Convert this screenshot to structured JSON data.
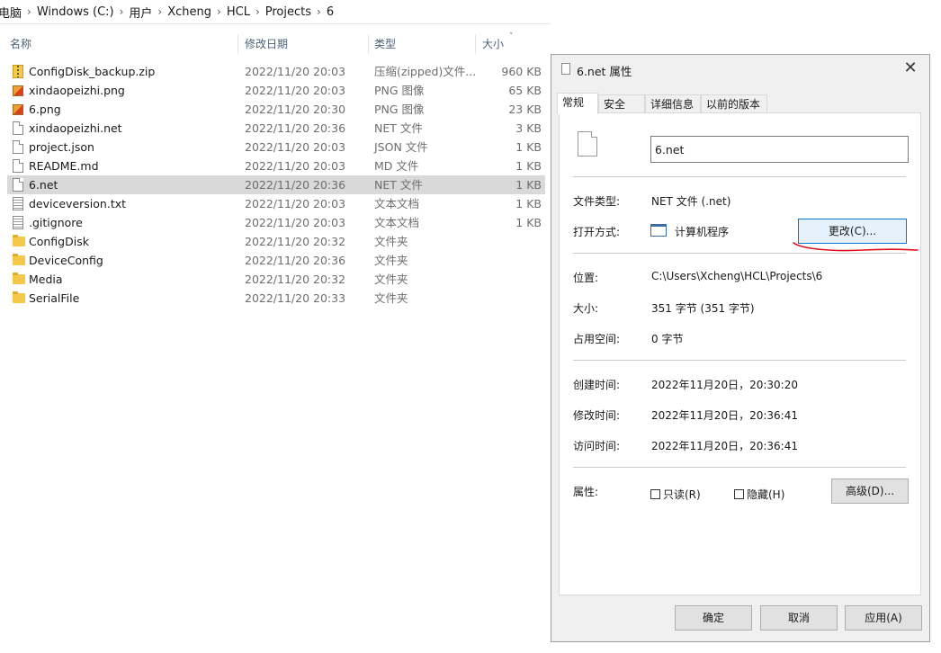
{
  "breadcrumb": [
    "电脑",
    "Windows (C:)",
    "用户",
    "Xcheng",
    "HCL",
    "Projects",
    "6"
  ],
  "columns": {
    "name": "名称",
    "date": "修改日期",
    "type": "类型",
    "size": "大小"
  },
  "files": [
    {
      "name": "ConfigDisk_backup.zip",
      "date": "2022/11/20 20:03",
      "type": "压缩(zipped)文件...",
      "size": "960 KB",
      "icon": "zip-icon"
    },
    {
      "name": "xindaopeizhi.png",
      "date": "2022/11/20 20:03",
      "type": "PNG 图像",
      "size": "65 KB",
      "icon": "image-icon"
    },
    {
      "name": "6.png",
      "date": "2022/11/20 20:30",
      "type": "PNG 图像",
      "size": "23 KB",
      "icon": "image-icon"
    },
    {
      "name": "xindaopeizhi.net",
      "date": "2022/11/20 20:36",
      "type": "NET 文件",
      "size": "3 KB",
      "icon": "file-icon"
    },
    {
      "name": "project.json",
      "date": "2022/11/20 20:03",
      "type": "JSON 文件",
      "size": "1 KB",
      "icon": "file-icon"
    },
    {
      "name": "README.md",
      "date": "2022/11/20 20:03",
      "type": "MD 文件",
      "size": "1 KB",
      "icon": "file-icon"
    },
    {
      "name": "6.net",
      "date": "2022/11/20 20:36",
      "type": "NET 文件",
      "size": "1 KB",
      "icon": "file-icon",
      "selected": true
    },
    {
      "name": "deviceversion.txt",
      "date": "2022/11/20 20:03",
      "type": "文本文档",
      "size": "1 KB",
      "icon": "text-file-icon"
    },
    {
      "name": ".gitignore",
      "date": "2022/11/20 20:03",
      "type": "文本文档",
      "size": "1 KB",
      "icon": "text-file-icon"
    },
    {
      "name": "ConfigDisk",
      "date": "2022/11/20 20:32",
      "type": "文件夹",
      "size": "",
      "icon": "folder-icon"
    },
    {
      "name": "DeviceConfig",
      "date": "2022/11/20 20:36",
      "type": "文件夹",
      "size": "",
      "icon": "folder-icon"
    },
    {
      "name": "Media",
      "date": "2022/11/20 20:32",
      "type": "文件夹",
      "size": "",
      "icon": "folder-icon"
    },
    {
      "name": "SerialFile",
      "date": "2022/11/20 20:33",
      "type": "文件夹",
      "size": "",
      "icon": "folder-icon"
    }
  ],
  "dialog": {
    "title": "6.net 属性",
    "close": "✕",
    "tabs": [
      "常规",
      "安全",
      "详细信息",
      "以前的版本"
    ],
    "active_tab": "常规",
    "filename": "6.net",
    "file_type_label": "文件类型:",
    "file_type_value": "NET 文件 (.net)",
    "opens_with_label": "打开方式:",
    "opens_with_value": "计算机程序",
    "change_button": "更改(C)...",
    "location_label": "位置:",
    "location_value": "C:\\Users\\Xcheng\\HCL\\Projects\\6",
    "size_label": "大小:",
    "size_value": "351 字节 (351 字节)",
    "size_on_disk_label": "占用空间:",
    "size_on_disk_value": "0 字节",
    "created_label": "创建时间:",
    "created_value": "2022年11月20日，20:30:20",
    "modified_label": "修改时间:",
    "modified_value": "2022年11月20日，20:36:41",
    "accessed_label": "访问时间:",
    "accessed_value": "2022年11月20日，20:36:41",
    "attributes_label": "属性:",
    "readonly_label": "只读(R)",
    "readonly_checked": false,
    "hidden_label": "隐藏(H)",
    "hidden_checked": false,
    "advanced_button": "高级(D)...",
    "ok_button": "确定",
    "cancel_button": "取消",
    "apply_button": "应用(A)"
  },
  "colors": {
    "selection": "#d9d9d9",
    "dialog_bg": "#f0f0f0",
    "focus_border": "#0078d7",
    "annotation": "#e0101a"
  }
}
